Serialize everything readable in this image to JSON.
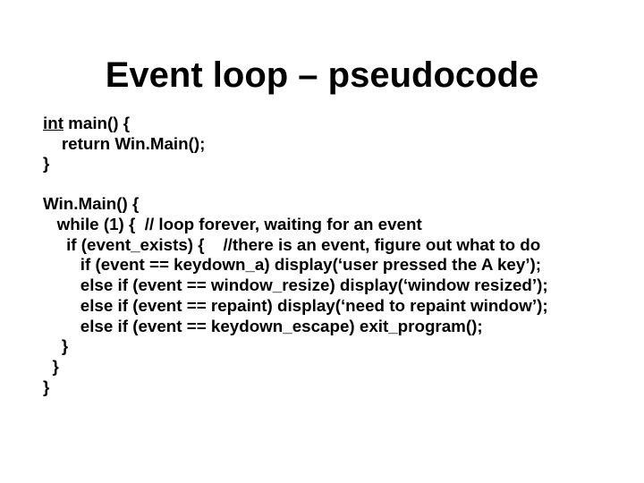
{
  "title": "Event loop – pseudocode",
  "code": {
    "main": {
      "sig_prefix": "int",
      "sig_rest": " main() {",
      "ret": "    return Win.Main();",
      "close": "}"
    },
    "win": {
      "sig": "Win.Main() {",
      "while": "   while (1) {  // loop forever, waiting for an event",
      "if_exists": "     if (event_exists) {    //there is an event, figure out what to do",
      "keydown_a": "        if (event == keydown_a) display(‘user pressed the A key’);",
      "window_resize": "        else if (event == window_resize) display(‘window resized’);",
      "repaint": "        else if (event == repaint) display(‘need to repaint window’);",
      "keydown_escape": "        else if (event == keydown_escape) exit_program();",
      "close_if": "    }",
      "close_while": "  }",
      "close_fn": "}"
    }
  }
}
